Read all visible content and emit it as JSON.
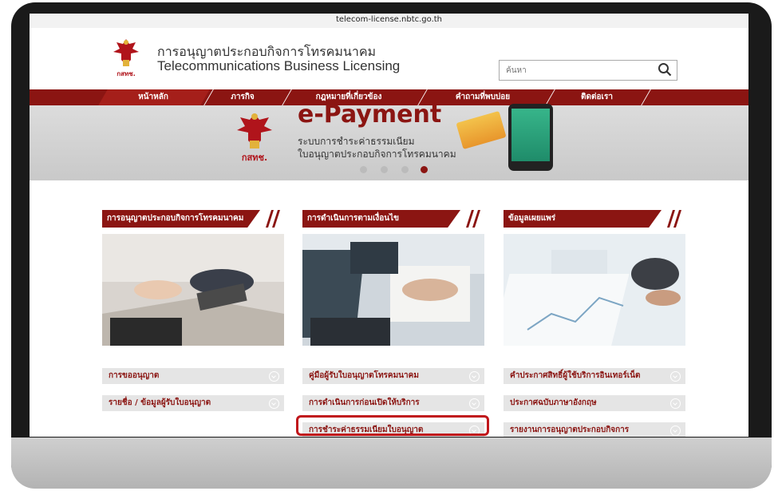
{
  "browser": {
    "url": "telecom-license.nbtc.go.th"
  },
  "header": {
    "title_th": "การอนุญาตประกอบกิจการโทรคมนาคม",
    "title_en": "Telecommunications Business Licensing",
    "logo_text": "กสทช.",
    "search_placeholder": "ค้นหา"
  },
  "nav": {
    "items": [
      {
        "label": "หน้าหลัก",
        "active": true
      },
      {
        "label": "ภารกิจ"
      },
      {
        "label": "กฎหมายที่เกี่ยวข้อง"
      },
      {
        "label": "คำถามที่พบบ่อย"
      },
      {
        "label": "ติดต่อเรา"
      }
    ]
  },
  "banner": {
    "title": "e-Payment",
    "subtitle_line1": "ระบบการชำระค่าธรรมเนียม",
    "subtitle_line2": "ใบอนุญาตประกอบกิจการโทรคมนาคม",
    "logo_text": "กสทช.",
    "slide_count": 4,
    "active_slide": 4
  },
  "columns": [
    {
      "heading": "การอนุญาตประกอบกิจการโทรคมนาคม",
      "links": [
        "การขออนุญาต",
        "รายชื่อ / ข้อมูลผู้รับใบอนุญาต"
      ]
    },
    {
      "heading": "การดำเนินการตามเงื่อนไข",
      "links": [
        "คู่มือผู้รับใบอนุญาตโทรคมนาคม",
        "การดำเนินการก่อนเปิดให้บริการ",
        "การชำระค่าธรรมเนียมใบอนุญาต"
      ]
    },
    {
      "heading": "ข้อมูลเผยแพร่",
      "links": [
        "คำประกาศสิทธิ์ผู้ใช้บริการอินเทอร์เน็ต",
        "ประกาศฉบับภาษาอังกฤษ",
        "รายงานการอนุญาตประกอบกิจการ"
      ]
    }
  ],
  "colors": {
    "brand_red": "#8b1512",
    "highlight": "#c0161b"
  }
}
